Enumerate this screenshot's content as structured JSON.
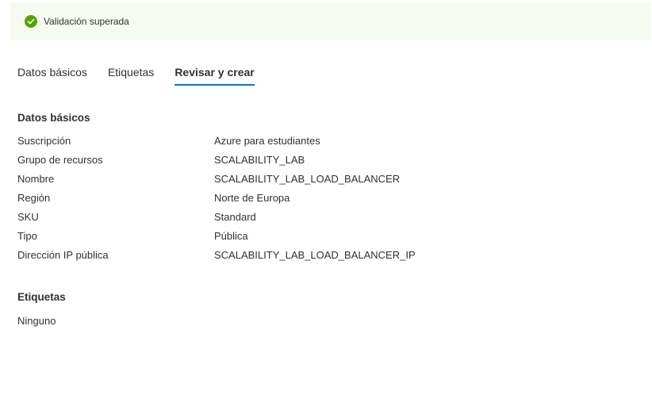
{
  "banner": {
    "icon": "check-circle-icon",
    "text": "Validación superada",
    "color": "#57a300"
  },
  "tabs": [
    {
      "label": "Datos básicos",
      "active": false
    },
    {
      "label": "Etiquetas",
      "active": false
    },
    {
      "label": "Revisar y crear",
      "active": true
    }
  ],
  "basics": {
    "title": "Datos básicos",
    "rows": [
      {
        "label": "Suscripción",
        "value": "Azure para estudiantes"
      },
      {
        "label": "Grupo de recursos",
        "value": "SCALABILITY_LAB"
      },
      {
        "label": "Nombre",
        "value": "SCALABILITY_LAB_LOAD_BALANCER"
      },
      {
        "label": "Región",
        "value": "Norte de Europa"
      },
      {
        "label": "SKU",
        "value": "Standard"
      },
      {
        "label": "Tipo",
        "value": "Pública"
      },
      {
        "label": "Dirección IP pública",
        "value": "SCALABILITY_LAB_LOAD_BALANCER_IP"
      }
    ]
  },
  "tags": {
    "title": "Etiquetas",
    "value": "Ninguno"
  },
  "accent_color": "#0078d4"
}
